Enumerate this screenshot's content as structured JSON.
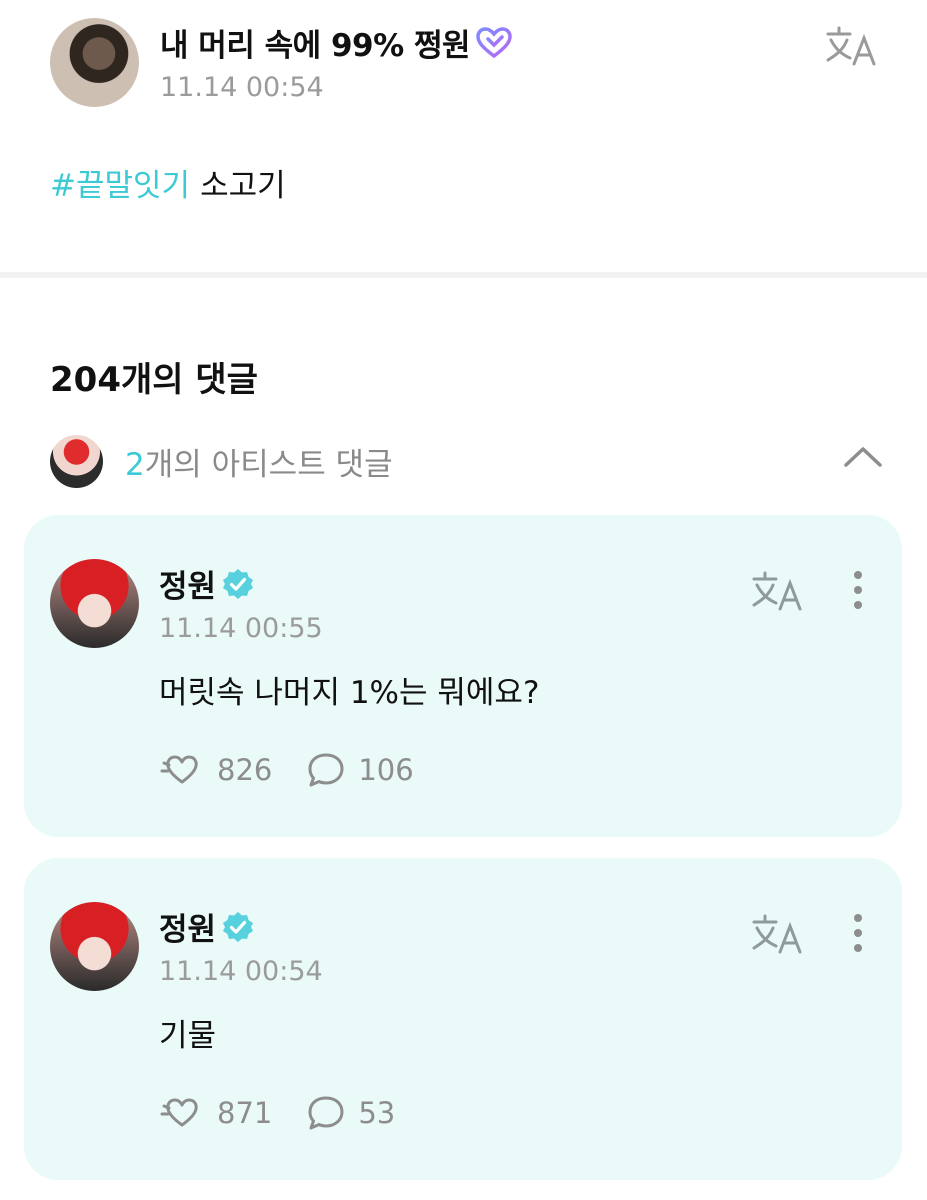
{
  "post": {
    "author": "내 머리 속에 99% 쩡원",
    "time": "11.14 00:54",
    "hashtag": "#끝말잇기",
    "text": "소고기"
  },
  "comments_header": "204개의 댓글",
  "artist_comments": {
    "count": "2",
    "label": "개의 아티스트 댓글"
  },
  "comments": [
    {
      "author": "정원",
      "time": "11.14 00:55",
      "text": "머릿속 나머지 1%는 뭐에요?",
      "likes": "826",
      "replies": "106"
    },
    {
      "author": "정원",
      "time": "11.14 00:54",
      "text": "기물",
      "likes": "871",
      "replies": "53"
    }
  ],
  "colors": {
    "accent": "#3ccad5",
    "card_bg": "#e9faf8",
    "verified": "#56d1dd"
  },
  "icons": [
    "translate-icon",
    "heart-badge-icon",
    "verified-icon",
    "chevron-up-icon",
    "more-icon",
    "like-icon",
    "reply-icon"
  ]
}
